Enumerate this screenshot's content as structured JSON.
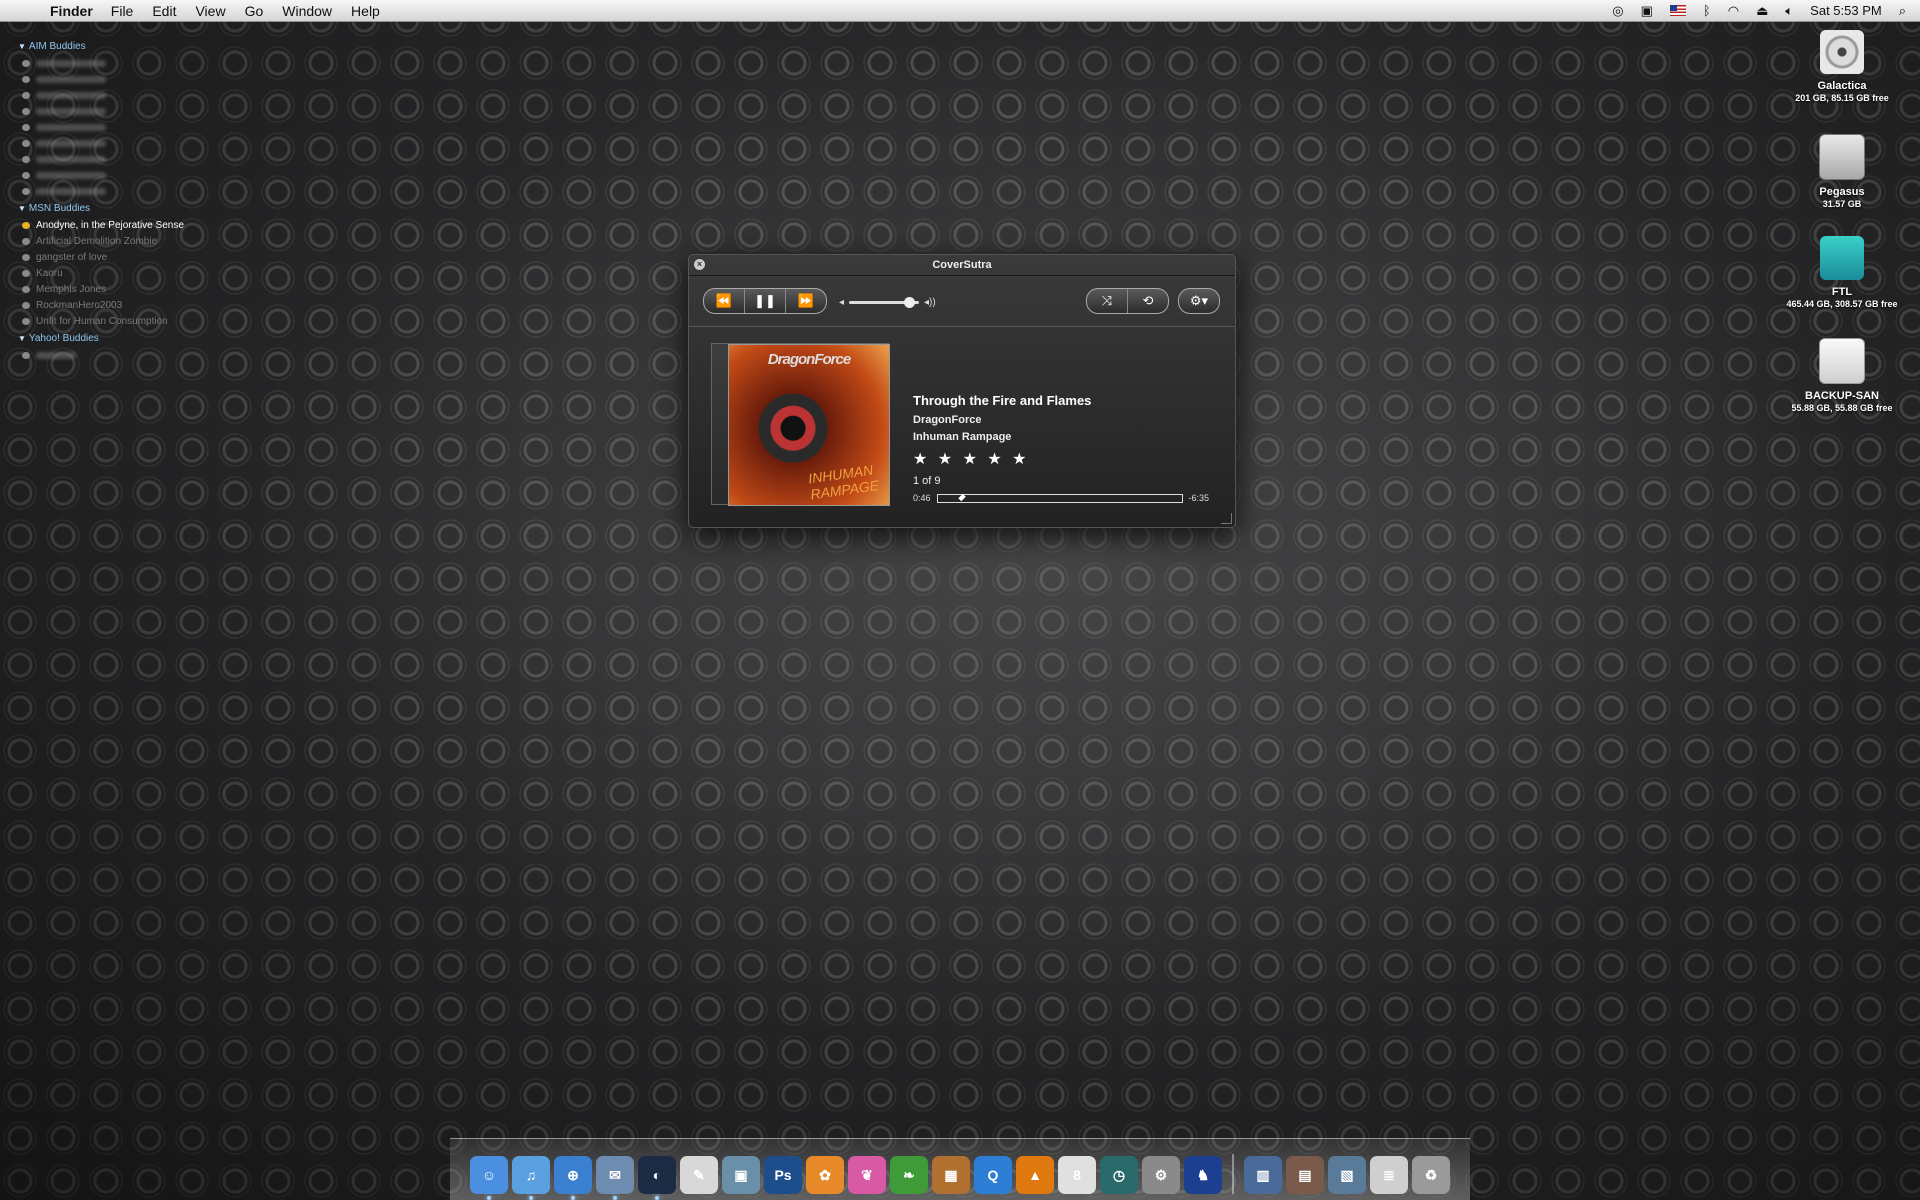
{
  "menubar": {
    "apple": "",
    "app": "Finder",
    "menus": [
      "File",
      "Edit",
      "View",
      "Go",
      "Window",
      "Help"
    ],
    "clock": "Sat 5:53 PM"
  },
  "buddy_list": {
    "groups": [
      {
        "name": "AIM Buddies",
        "buddies_hidden": 9
      },
      {
        "name": "MSN Buddies",
        "buddies": [
          "Anodyne, in the Pejorative Sense",
          "Artificial Demolition Zombie",
          "gangster of love",
          "Kaoru",
          "Memphis Jones",
          "RockmanHero2003",
          "Unfit for Human Consumption"
        ]
      },
      {
        "name": "Yahoo! Buddies",
        "buddies_hidden": 1
      }
    ]
  },
  "desktop": {
    "icons": [
      {
        "name": "Galactica",
        "sub": "201 GB, 85.15 GB free"
      },
      {
        "name": "Pegasus",
        "sub": "31.57 GB"
      },
      {
        "name": "FTL",
        "sub": "465.44 GB, 308.57 GB free"
      },
      {
        "name": "BACKUP-SAN",
        "sub": "55.88 GB, 55.88 GB free"
      }
    ]
  },
  "player": {
    "title": "CoverSutra",
    "close": "×",
    "controls": {
      "prev": "⏪",
      "pause": "❚❚",
      "next": "⏩",
      "shuffle": "⤨",
      "repeat": "⟲",
      "gear": "⚙▾"
    },
    "volume_fraction": 0.85,
    "track": "Through the Fire and Flames",
    "artist": "DragonForce",
    "album": "Inhuman Rampage",
    "stars": "★ ★ ★ ★ ★",
    "rating": 5,
    "position": "1 of 9",
    "elapsed": "0:46",
    "remaining": "-6:35",
    "progress_fraction": 0.1,
    "cover": {
      "band_logo": "DragonForce",
      "album_text": "INHUMAN RAMPAGE"
    }
  },
  "dock": {
    "items": [
      {
        "name": "finder-icon",
        "glyph": "☺",
        "color": "#4a8fe0",
        "running": true
      },
      {
        "name": "itunes-icon",
        "glyph": "♫",
        "color": "#5aa0e0",
        "running": true
      },
      {
        "name": "safari-icon",
        "glyph": "⊕",
        "color": "#3b7fd0",
        "running": true
      },
      {
        "name": "mail-icon",
        "glyph": "✉",
        "color": "#6e8cb0",
        "running": true
      },
      {
        "name": "adium-icon",
        "glyph": "◐",
        "color": "#1c2b44",
        "running": true
      },
      {
        "name": "textedit-icon",
        "glyph": "✎",
        "color": "#d8d8d8",
        "running": false
      },
      {
        "name": "iphoto-icon",
        "glyph": "▣",
        "color": "#6a8fa8",
        "running": false
      },
      {
        "name": "photoshop-icon",
        "glyph": "Ps",
        "color": "#1d4e8c",
        "running": false
      },
      {
        "name": "flower-app-icon",
        "glyph": "✿",
        "color": "#e88a2a",
        "running": false
      },
      {
        "name": "butterfly-app-icon",
        "glyph": "❦",
        "color": "#d85aa5",
        "running": false
      },
      {
        "name": "leaf-app-icon",
        "glyph": "❧",
        "color": "#3f9a38",
        "running": false
      },
      {
        "name": "photo-booth-icon",
        "glyph": "▦",
        "color": "#b07030",
        "running": false
      },
      {
        "name": "quicktime-icon",
        "glyph": "Q",
        "color": "#2c7fd4",
        "running": false
      },
      {
        "name": "vlc-icon",
        "glyph": "▲",
        "color": "#e07a10",
        "running": false
      },
      {
        "name": "ical-icon",
        "glyph": "8",
        "color": "#e0e0e0",
        "running": false
      },
      {
        "name": "time-machine-icon",
        "glyph": "◷",
        "color": "#2a6a6a",
        "running": false
      },
      {
        "name": "system-preferences-icon",
        "glyph": "⚙",
        "color": "#8a8a8a",
        "running": false
      },
      {
        "name": "dragon-app-icon",
        "glyph": "♞",
        "color": "#1d3f8f",
        "running": false
      },
      {
        "name": "folder-stack-icon",
        "glyph": "▥",
        "color": "#4a6a9a",
        "running": false
      },
      {
        "name": "book-stack-icon",
        "glyph": "▤",
        "color": "#7a5a4a",
        "running": false
      },
      {
        "name": "picture-stack-icon",
        "glyph": "▧",
        "color": "#5a7a9a",
        "running": false
      },
      {
        "name": "document-stack-icon",
        "glyph": "≣",
        "color": "#cfcfcf",
        "running": false
      },
      {
        "name": "trash-icon",
        "glyph": "♻",
        "color": "#9a9a9a",
        "running": false
      }
    ]
  }
}
